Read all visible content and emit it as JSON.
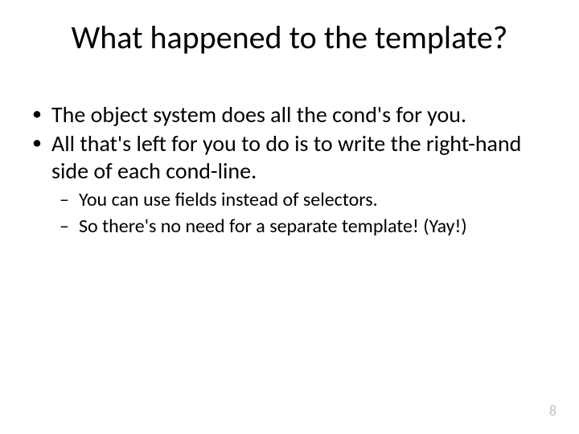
{
  "title": "What happened to the template?",
  "bullets": [
    {
      "text": "The object system does all the cond's for you."
    },
    {
      "text": "All that's left for you to do is to write the right-hand side of each cond-line.",
      "sub": [
        "You can use fields instead of selectors.",
        "So there's no need for a separate template! (Yay!)"
      ]
    }
  ],
  "page_number": "8"
}
